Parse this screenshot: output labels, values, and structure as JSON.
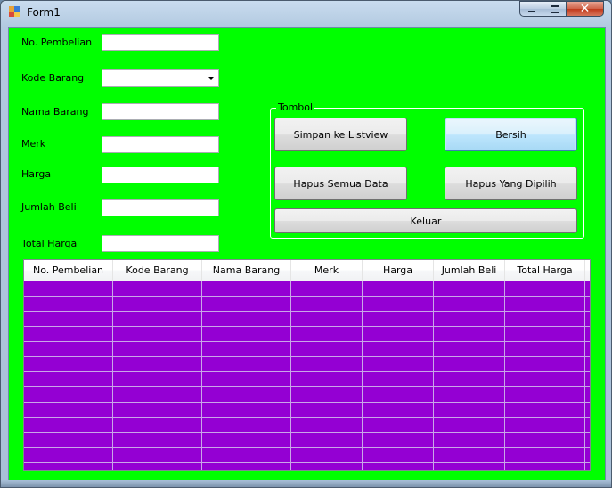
{
  "window": {
    "title": "Form1",
    "controls": {
      "close_glyph": "✕"
    }
  },
  "form": {
    "labels": {
      "no_pembelian": "No. Pembelian",
      "kode_barang": "Kode Barang",
      "nama_barang": "Nama Barang",
      "merk": "Merk",
      "harga": "Harga",
      "jumlah_beli": "Jumlah Beli",
      "total_harga": "Total Harga"
    },
    "values": {
      "no_pembelian": "",
      "kode_barang": "",
      "nama_barang": "",
      "merk": "",
      "harga": "",
      "jumlah_beli": "",
      "total_harga": ""
    }
  },
  "group": {
    "title": "Tombol",
    "buttons": {
      "simpan": "Simpan ke Listview",
      "bersih": "Bersih",
      "hapus_semua": "Hapus Semua Data",
      "hapus_dipilih": "Hapus Yang Dipilih",
      "keluar": "Keluar"
    }
  },
  "listview": {
    "columns": [
      "No. Pembelian",
      "Kode Barang",
      "Nama Barang",
      "Merk",
      "Harga",
      "Jumlah Beli",
      "Total Harga"
    ],
    "rows": []
  },
  "colors": {
    "form_background": "#00ff00",
    "listview_background": "#9400d3"
  }
}
